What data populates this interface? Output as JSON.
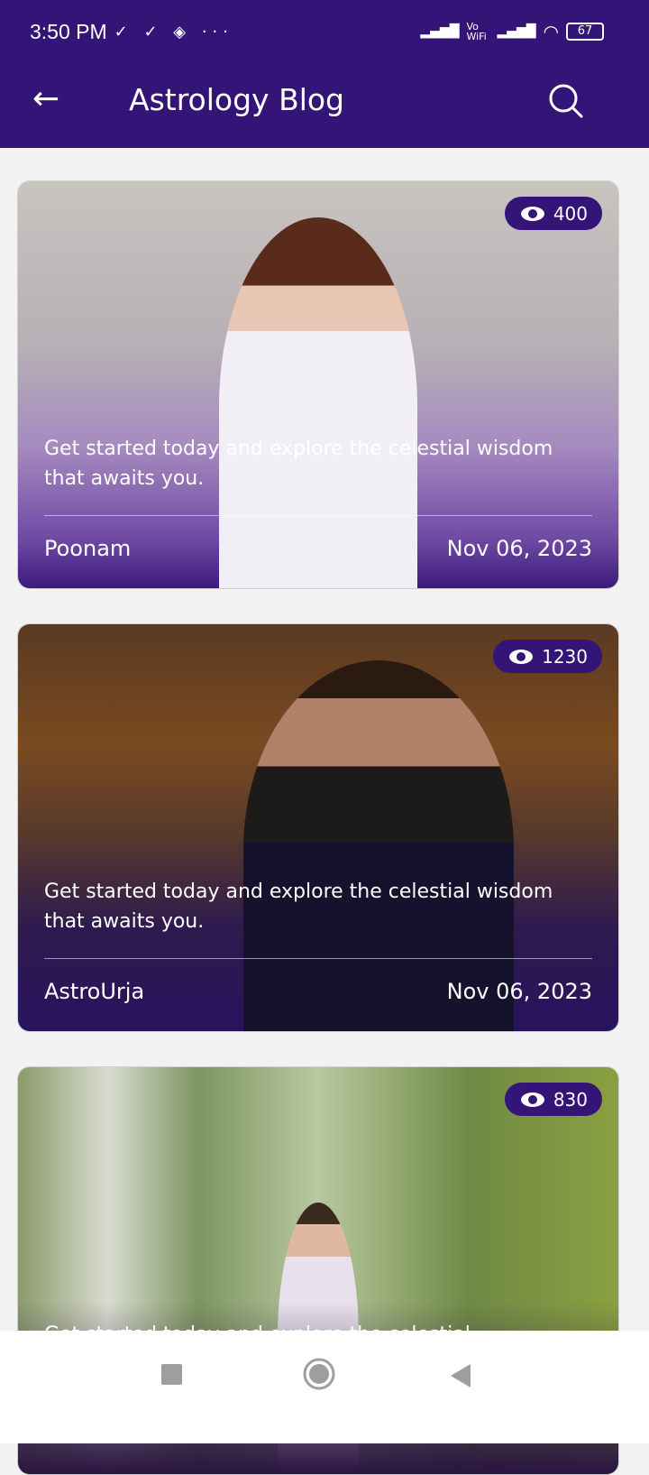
{
  "status_bar": {
    "time": "3:50 PM",
    "notification_icons": [
      "check-download-icon",
      "check-download-icon",
      "layers-icon",
      "more-dots-icon"
    ],
    "network": "Vo WiFi",
    "battery": "67"
  },
  "app_bar": {
    "title": "Astrology Blog",
    "back_icon": "arrow-left-icon",
    "search_icon": "search-icon"
  },
  "colors": {
    "primary": "#341476",
    "background": "#f2f2f2"
  },
  "posts": [
    {
      "views": "400",
      "caption": "Get started today and explore the celestial wisdom that awaits you.",
      "author": "Poonam",
      "date": "Nov 06, 2023"
    },
    {
      "views": "1230",
      "caption": "Get started today and explore the celestial wisdom that awaits you.",
      "author": "AstroUrja",
      "date": "Nov 06, 2023"
    },
    {
      "views": "830",
      "caption": "Get started today and explore the celestial"
    }
  ],
  "nav_bar": {
    "buttons": [
      "recents-square-icon",
      "home-circle-icon",
      "back-triangle-icon"
    ]
  }
}
